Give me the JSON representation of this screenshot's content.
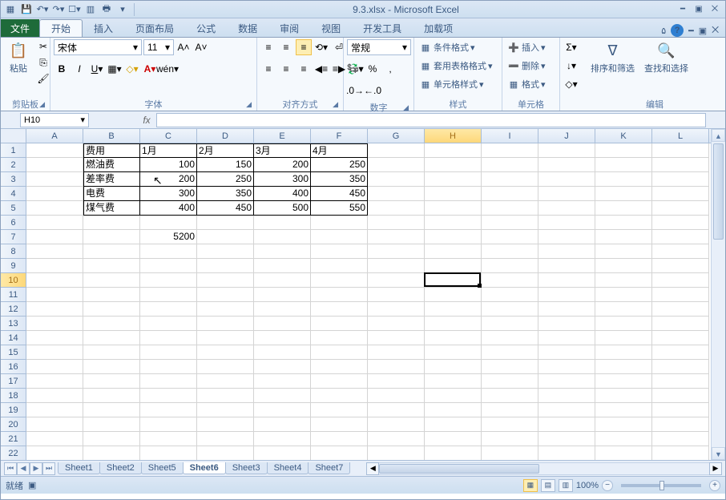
{
  "title": "9.3.xlsx - Microsoft Excel",
  "tabs": {
    "file": "文件",
    "home": "开始",
    "insert": "插入",
    "layout": "页面布局",
    "formulas": "公式",
    "data": "数据",
    "review": "审阅",
    "view": "视图",
    "dev": "开发工具",
    "addins": "加载项"
  },
  "ribbon": {
    "clipboard": {
      "paste": "粘贴",
      "label": "剪贴板"
    },
    "font": {
      "name": "宋体",
      "size": "11",
      "label": "字体"
    },
    "align": {
      "label": "对齐方式"
    },
    "number": {
      "format": "常规",
      "label": "数字"
    },
    "styles": {
      "cond": "条件格式",
      "table": "套用表格格式",
      "cell": "单元格样式",
      "label": "样式"
    },
    "cells": {
      "insert": "插入",
      "delete": "删除",
      "format": "格式",
      "label": "单元格"
    },
    "editing": {
      "sort": "排序和筛选",
      "find": "查找和选择",
      "label": "编辑"
    }
  },
  "namebox": "H10",
  "fx": "fx",
  "columns": [
    "A",
    "B",
    "C",
    "D",
    "E",
    "F",
    "G",
    "H",
    "I",
    "J",
    "K",
    "L"
  ],
  "sel_col": "H",
  "sel_row": 10,
  "table": {
    "header": [
      "费用",
      "1月",
      "2月",
      "3月",
      "4月"
    ],
    "rows": [
      [
        "燃油费",
        "100",
        "150",
        "200",
        "250"
      ],
      [
        "差率费",
        "200",
        "250",
        "300",
        "350"
      ],
      [
        "电费",
        "300",
        "350",
        "400",
        "450"
      ],
      [
        "煤气费",
        "400",
        "450",
        "500",
        "550"
      ]
    ]
  },
  "extra_cell": {
    "row": 7,
    "col": "C",
    "value": "5200"
  },
  "sheets": [
    "Sheet1",
    "Sheet2",
    "Sheet5",
    "Sheet6",
    "Sheet3",
    "Sheet4",
    "Sheet7"
  ],
  "active_sheet": "Sheet6",
  "status": {
    "ready": "就绪",
    "zoom": "100%"
  }
}
